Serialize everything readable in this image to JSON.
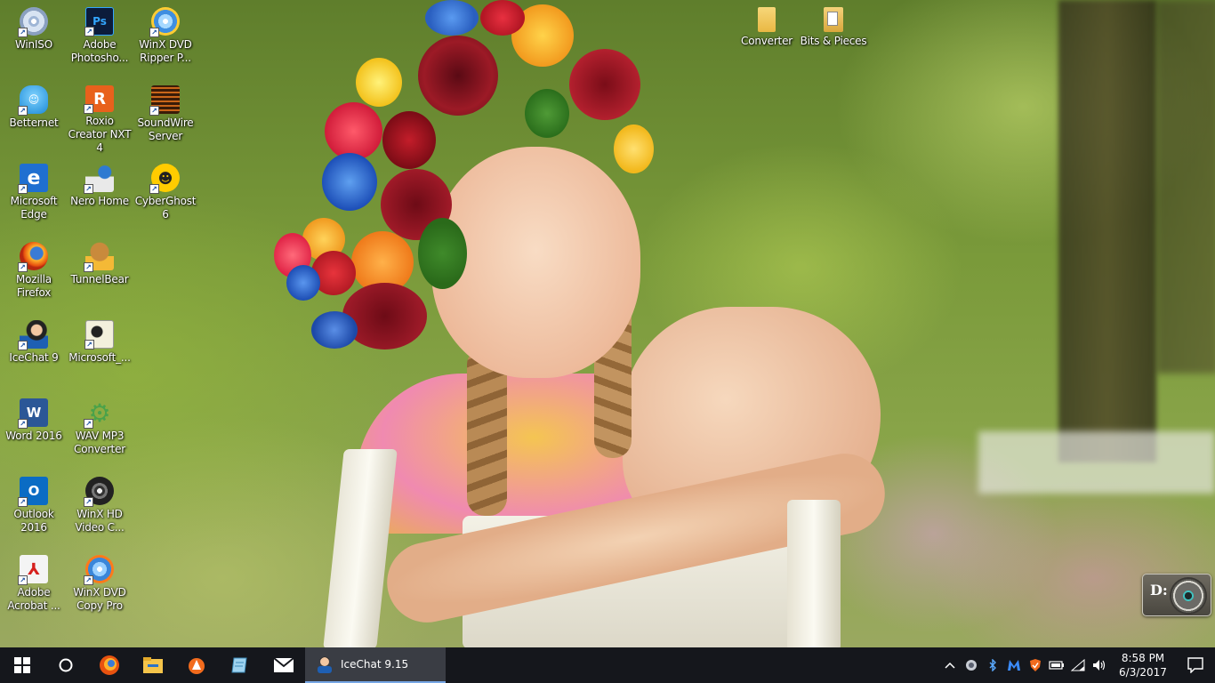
{
  "desktop": {
    "icons": [
      {
        "label": "WinISO",
        "icon": "winiso-icon"
      },
      {
        "label": "Adobe Photosho...",
        "icon": "photoshop-icon"
      },
      {
        "label": "WinX DVD Ripper P...",
        "icon": "winx-dvd-ripper-icon"
      },
      {
        "label": "Betternet",
        "icon": "betternet-icon"
      },
      {
        "label": "Roxio Creator NXT 4",
        "icon": "roxio-icon"
      },
      {
        "label": "SoundWire Server",
        "icon": "soundwire-icon"
      },
      {
        "label": "Microsoft Edge",
        "icon": "edge-icon"
      },
      {
        "label": "Nero Home",
        "icon": "nero-icon"
      },
      {
        "label": "CyberGhost 6",
        "icon": "cyberghost-icon"
      },
      {
        "label": "Mozilla Firefox",
        "icon": "firefox-icon"
      },
      {
        "label": "TunnelBear",
        "icon": "tunnelbear-icon"
      },
      {
        "label": "IceChat 9",
        "icon": "icechat-icon"
      },
      {
        "label": "Microsoft_...",
        "icon": "microsoft-file-icon"
      },
      {
        "label": "Word 2016",
        "icon": "word-icon"
      },
      {
        "label": "WAV MP3 Converter",
        "icon": "wav-mp3-icon"
      },
      {
        "label": "Outlook 2016",
        "icon": "outlook-icon"
      },
      {
        "label": "WinX HD Video C...",
        "icon": "winx-hd-video-icon"
      },
      {
        "label": "Adobe Acrobat ...",
        "icon": "acrobat-icon"
      },
      {
        "label": "WinX DVD Copy Pro",
        "icon": "winx-dvd-copy-icon"
      },
      {
        "label": "Converter",
        "icon": "folder-icon"
      },
      {
        "label": "Bits & Pieces",
        "icon": "folder-icon"
      }
    ],
    "drive_widget": {
      "letter": "D:"
    }
  },
  "taskbar": {
    "start": "windows-start-icon",
    "search": "cortana-circle-icon",
    "pinned": [
      "firefox-icon",
      "file-explorer-icon",
      "avast-icon",
      "notepad-icon",
      "mail-icon"
    ],
    "running_app": {
      "label": "IceChat 9.15",
      "icon": "icechat-icon"
    },
    "tray": [
      "chevron-up-icon",
      "shield-icon",
      "bluetooth-icon",
      "malwarebytes-icon",
      "avast-shield-icon",
      "battery-icon",
      "wifi-icon",
      "volume-icon"
    ],
    "clock": {
      "time": "8:58 PM",
      "date": "6/3/2017"
    },
    "notification": "action-center-icon"
  },
  "colors": {
    "taskbar_bg": "#15171c",
    "accent": "#76a6e5"
  }
}
